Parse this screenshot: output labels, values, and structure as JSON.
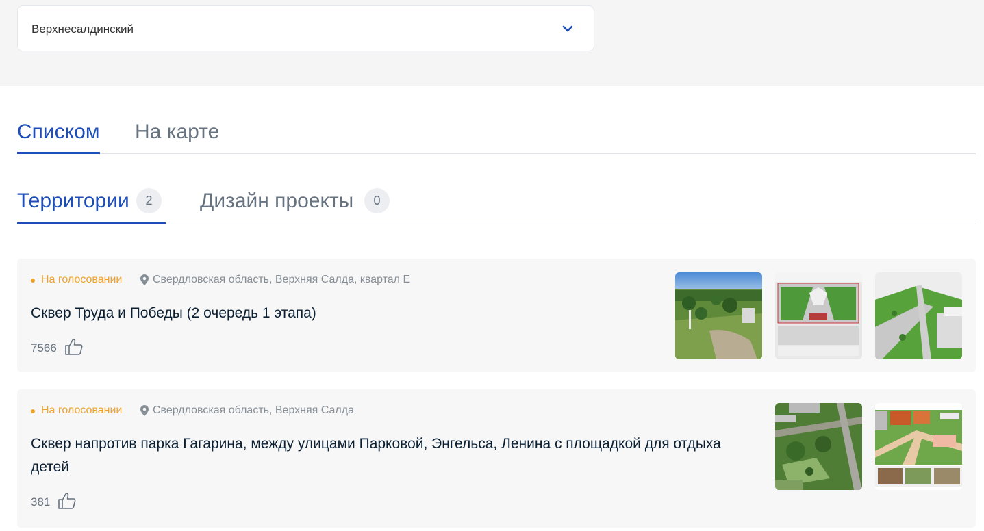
{
  "filter": {
    "municipality": "Верхнесалдинский",
    "chevron_icon": "chevron-down-icon",
    "accent_color": "#1c4db8"
  },
  "view_tabs": [
    {
      "label": "Списком",
      "active": true
    },
    {
      "label": "На карте",
      "active": false
    }
  ],
  "content_tabs": [
    {
      "label": "Территории",
      "count": "2",
      "active": true
    },
    {
      "label": "Дизайн проекты",
      "count": "0",
      "active": false
    }
  ],
  "territories": [
    {
      "status": "На голосовании",
      "status_color": "#f0a22b",
      "location": "Свердловская область, Верхняя Салда, квартал Е",
      "title": "Сквер Труда и Победы (2 очередь 1 этапа)",
      "likes": "7566",
      "photos": [
        "aerial-photo",
        "site-plan-drawing",
        "3d-render"
      ]
    },
    {
      "status": "На голосовании",
      "status_color": "#f0a22b",
      "location": "Свердловская область, Верхняя Салда",
      "title": "Сквер напротив парка Гагарина, между улицами Парковой, Энгельса, Ленина с площадкой для отдыха детей",
      "likes": "381",
      "photos": [
        "aerial-photo",
        "design-board"
      ]
    }
  ]
}
